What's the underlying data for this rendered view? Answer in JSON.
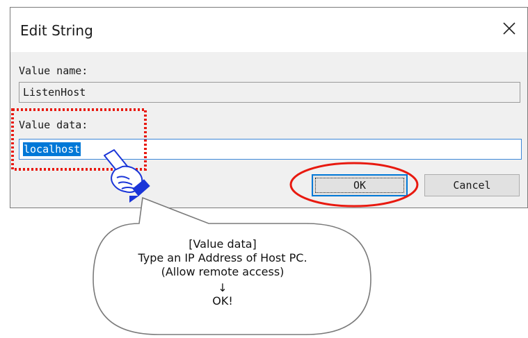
{
  "dialog": {
    "title": "Edit String",
    "value_name_label": "Value name:",
    "value_name": "ListenHost",
    "value_data_label": "Value data:",
    "value_data": "localhost",
    "ok_label": "OK",
    "cancel_label": "Cancel"
  },
  "annotation": {
    "heading": "[Value data]",
    "line1": "Type an IP Address of Host PC.",
    "line2": "(Allow remote access)",
    "arrow": "↓",
    "line3": "OK!"
  },
  "colors": {
    "highlight_box": "#e8190f",
    "selection": "#0078d7",
    "ok_ellipse": "#e8190f",
    "hand_cuff": "#1a35d8"
  },
  "icons": {
    "close": "close-icon",
    "pointer": "pointing-hand-icon"
  }
}
